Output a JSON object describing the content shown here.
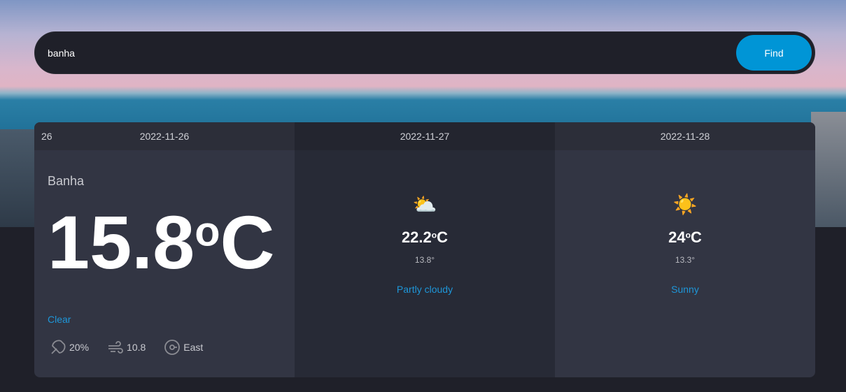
{
  "search": {
    "value": "banha",
    "button": "Find"
  },
  "today": {
    "day": "26",
    "date": "2022-11-26",
    "location": "Banha",
    "temp": "15.8",
    "unit": "C",
    "degree": "o",
    "condition": "Clear",
    "precip": "20%",
    "wind": "10.8",
    "direction": "East"
  },
  "forecast": [
    {
      "date": "2022-11-27",
      "icon": "⛅",
      "temp": "22.2",
      "unit": "C",
      "degree": "o",
      "min": "13.8°",
      "condition": "Partly cloudy"
    },
    {
      "date": "2022-11-28",
      "icon": "☀️",
      "temp": "24",
      "unit": "C",
      "degree": "o",
      "min": "13.3°",
      "condition": "Sunny"
    }
  ]
}
